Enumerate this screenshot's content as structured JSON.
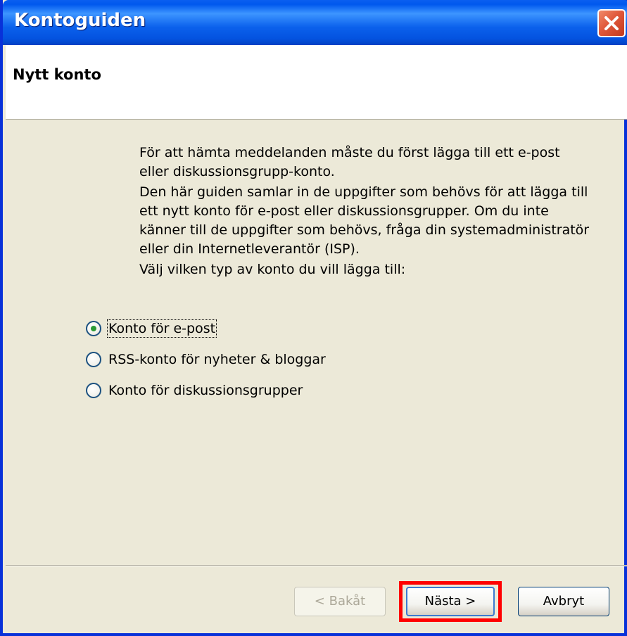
{
  "window": {
    "title": "Kontoguiden",
    "close_icon": "close-icon"
  },
  "header": {
    "title": "Nytt konto"
  },
  "content": {
    "paragraph1": "För att hämta meddelanden måste du först lägga till ett e-post eller diskussionsgrupp-konto.",
    "paragraph2": "Den här guiden samlar in de uppgifter som behövs för att lägga till ett nytt konto för e-post eller diskussionsgrupper. Om du inte känner till de uppgifter som behövs, fråga din systemadministratör eller din Internetleverantör (ISP).",
    "prompt": "Välj vilken typ av konto du vill lägga till:",
    "options": [
      {
        "label": "Konto för e-post",
        "checked": true
      },
      {
        "label": "RSS-konto för nyheter & bloggar",
        "checked": false
      },
      {
        "label": "Konto för diskussionsgrupper",
        "checked": false
      }
    ]
  },
  "buttons": {
    "back": "< Bakåt",
    "next": "Nästa >",
    "cancel": "Avbryt"
  },
  "colors": {
    "titlebar": "#0058ee",
    "dialog_bg": "#ece9d8",
    "highlight": "#ff0000",
    "radio_dot": "#2b9a35"
  }
}
